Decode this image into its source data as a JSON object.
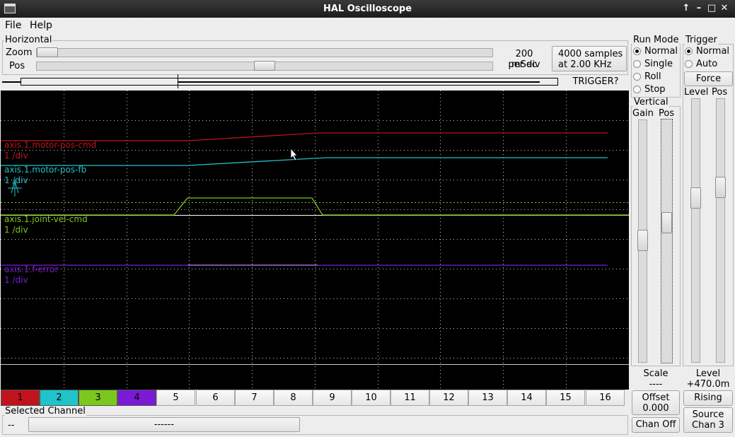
{
  "window": {
    "title": "HAL Oscilloscope",
    "controls": [
      "↑",
      "–",
      "□",
      "✕"
    ]
  },
  "menu": {
    "file": "File",
    "help": "Help"
  },
  "horizontal": {
    "label": "Horizontal",
    "zoom_label": "Zoom",
    "pos_label": "Pos",
    "time_per_div": "200 mSec",
    "per_div": "per div",
    "samples": "4000 samples",
    "rate": "at 2.00 KHz",
    "trigger_status": "TRIGGER?",
    "zoom_level": 0.0,
    "pos_level": 0.5
  },
  "run_mode": {
    "label": "Run Mode",
    "options": [
      "Normal",
      "Single",
      "Roll",
      "Stop"
    ],
    "selected": "Normal"
  },
  "trigger": {
    "label": "Trigger",
    "options": [
      "Normal",
      "Auto"
    ],
    "selected": "Normal",
    "force": "Force",
    "level_label": "Level",
    "pos_label": "Pos",
    "level_title": "Level",
    "level_value": "+470.0m",
    "edge": "Rising",
    "source_line1": "Source",
    "source_line2": "Chan  3"
  },
  "vertical": {
    "label": "Vertical",
    "gain_label": "Gain",
    "pos_label": "Pos",
    "scale_label": "Scale",
    "scale_value": "----",
    "offset_label": "Offset",
    "offset_value": "0.000",
    "chan_off": "Chan Off"
  },
  "traces": [
    {
      "name": "axis.1.motor-pos-cmd",
      "scale": "1 /div",
      "color": "#c0131b"
    },
    {
      "name": "axis.1.motor-pos-fb",
      "scale": "1 /div",
      "color": "#1fc3c9"
    },
    {
      "name": "axis.1.joint-vel-cmd",
      "scale": "1 /div",
      "color": "#7cc71e"
    },
    {
      "name": "axis.1.f-error",
      "scale": "1 /div",
      "color": "#7a1ad4"
    }
  ],
  "channels": [
    {
      "label": "1",
      "color": "#c0131b"
    },
    {
      "label": "2",
      "color": "#1fc3c9"
    },
    {
      "label": "3",
      "color": "#7cc71e"
    },
    {
      "label": "4",
      "color": "#7a1ad4"
    },
    {
      "label": "5"
    },
    {
      "label": "6"
    },
    {
      "label": "7"
    },
    {
      "label": "8"
    },
    {
      "label": "9"
    },
    {
      "label": "10"
    },
    {
      "label": "11"
    },
    {
      "label": "12"
    },
    {
      "label": "13"
    },
    {
      "label": "14"
    },
    {
      "label": "15"
    },
    {
      "label": "16"
    }
  ],
  "selected_channel": {
    "label": "Selected Channel",
    "number": "--",
    "name": "------"
  }
}
